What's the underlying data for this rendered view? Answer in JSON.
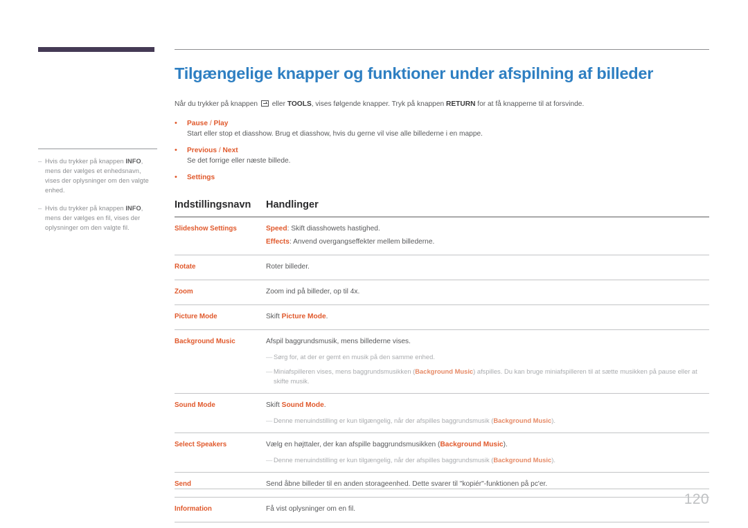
{
  "document": {
    "page_number": "120",
    "title": "Tilgængelige knapper og funktioner under afspilning af billeder",
    "title_color": "#2e7fc2",
    "accent_color": "#e0592c",
    "corner_bar_color": "#453a55"
  },
  "intro": {
    "before_icon": "Når du trykker på knappen",
    "icon": "enter-key-icon",
    "after_icon_1": " eller ",
    "tools_key": "TOOLS",
    "after_icon_2": ", vises følgende knapper. Tryk på knappen ",
    "return_key": "RETURN",
    "tail": " for at få knapperne til at forsvinde."
  },
  "bullets": [
    {
      "title_bold_1": "Pause",
      "separator": " / ",
      "title_bold_2": "Play",
      "description": "Start eller stop et diasshow. Brug et diasshow, hvis du gerne vil vise alle billederne i en mappe."
    },
    {
      "title_bold_1": "Previous",
      "separator": " / ",
      "title_bold_2": "Next",
      "description": "Se det forrige eller næste billede."
    },
    {
      "title_bold_1": "Settings",
      "separator": "",
      "title_bold_2": "",
      "description": ""
    }
  ],
  "table": {
    "headers": {
      "name": "Indstillingsnavn",
      "action": "Handlinger"
    },
    "rows": [
      {
        "name": "Slideshow Settings",
        "lines": [
          {
            "highlight": "Speed",
            "text": ": Skift diasshowets hastighed."
          },
          {
            "highlight": "Effects",
            "text": ": Anvend overgangseffekter mellem billederne."
          }
        ],
        "notes": []
      },
      {
        "name": "Rotate",
        "lines": [
          {
            "highlight": "",
            "text": "Roter billeder."
          }
        ],
        "notes": []
      },
      {
        "name": "Zoom",
        "lines": [
          {
            "highlight": "",
            "text": "Zoom ind på billeder, op til 4x."
          }
        ],
        "notes": []
      },
      {
        "name": "Picture Mode",
        "lines": [
          {
            "highlight": "",
            "text": "Skift ",
            "highlight_after": "Picture Mode",
            "text_after": "."
          }
        ],
        "notes": []
      },
      {
        "name": "Background Music",
        "lines": [
          {
            "highlight": "",
            "text": "Afspil baggrundsmusik, mens billederne vises."
          }
        ],
        "notes": [
          {
            "text_before": "Sørg for, at der er gemt en musik på den samme enhed.",
            "highlight": "",
            "text_after": ""
          },
          {
            "text_before": "Miniafspilleren vises, mens baggrundsmusikken (",
            "highlight": "Background Music",
            "text_after": ") afspilles. Du kan bruge miniafspilleren til at sætte musikken på pause eller at skifte musik."
          }
        ]
      },
      {
        "name": "Sound Mode",
        "lines": [
          {
            "highlight": "",
            "text": "Skift ",
            "highlight_after": "Sound Mode",
            "text_after": "."
          }
        ],
        "notes": [
          {
            "text_before": "Denne menuindstilling er kun tilgængelig, når der afspilles baggrundsmusik (",
            "highlight": "Background Music",
            "text_after": ")."
          }
        ]
      },
      {
        "name": "Select Speakers",
        "lines": [
          {
            "highlight": "",
            "text": "Vælg en højttaler, der kan afspille baggrundsmusikken (",
            "highlight_after": "Background Music",
            "text_after": ")."
          }
        ],
        "notes": [
          {
            "text_before": "Denne menuindstilling er kun tilgængelig, når der afspilles baggrundsmusik (",
            "highlight": "Background Music",
            "text_after": ")."
          }
        ]
      },
      {
        "name": "Send",
        "lines": [
          {
            "highlight": "",
            "text": "Send åbne billeder til en anden storageenhed. Dette svarer til \"kopiér\"-funktionen på pc'er."
          }
        ],
        "notes": []
      },
      {
        "name": "Information",
        "lines": [
          {
            "highlight": "",
            "text": "Få vist oplysninger om en fil."
          }
        ],
        "notes": []
      }
    ]
  },
  "sidebar": {
    "notes": [
      {
        "dash": "–",
        "before": "Hvis du trykker på knappen ",
        "key": "INFO",
        "after": ", mens der vælges et enhedsnavn, vises der oplysninger om den valgte enhed."
      },
      {
        "dash": "–",
        "before": "Hvis du trykker på knappen ",
        "key": "INFO",
        "after": ", mens der vælges en fil, vises der oplysninger om den valgte fil."
      }
    ]
  }
}
